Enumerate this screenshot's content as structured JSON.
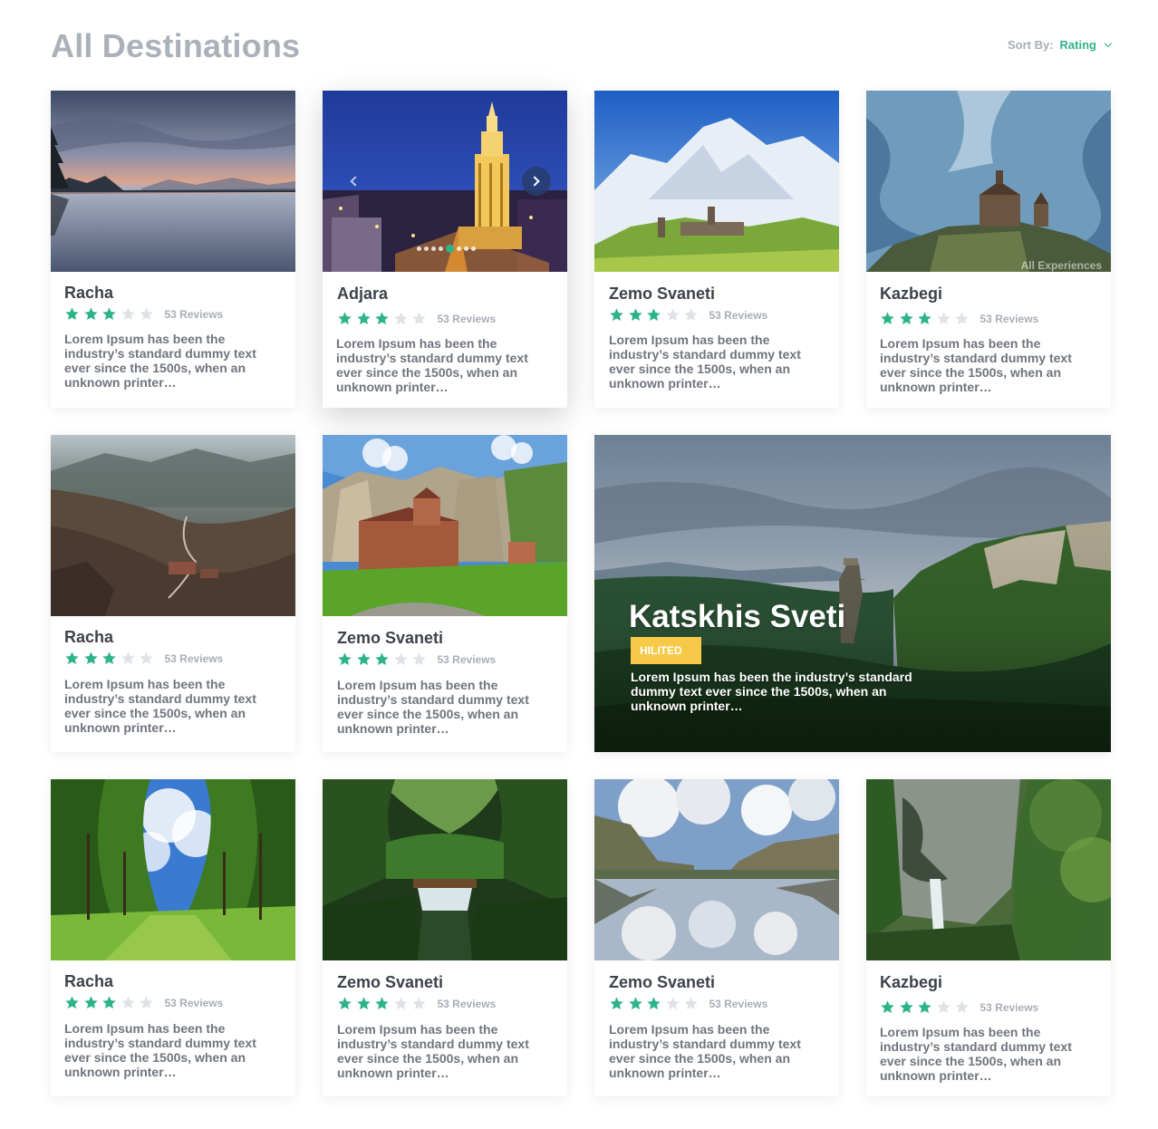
{
  "header": {
    "title": "All Destinations",
    "sort_label": "Sort By:",
    "sort_value": "Rating"
  },
  "cards": [
    {
      "name": "Racha",
      "rating": 3,
      "reviews": "53 Reviews",
      "desc": "Lorem Ipsum has been the industry’s standard dummy text ever since the 1500s, when an unknown printer…",
      "image": "lake-reflection-sunset"
    },
    {
      "name": "Adjara",
      "rating": 3,
      "reviews": "53 Reviews",
      "desc": "Lorem Ipsum has been the industry’s standard dummy text ever since the 1500s, when an unknown printer…",
      "image": "city-night-tower"
    },
    {
      "name": "Zemo Svaneti",
      "rating": 3,
      "reviews": "53 Reviews",
      "desc": "Lorem Ipsum has been the industry’s standard dummy text ever since the 1500s, when an unknown printer…",
      "image": "snow-mountain-village"
    },
    {
      "name": "Kazbegi",
      "rating": 3,
      "reviews": "53 Reviews",
      "desc": "Lorem Ipsum has been the industry’s standard dummy text ever since the 1500s, when an unknown printer…",
      "image": "church-snow-mountain",
      "overlay_link": "All Experiences"
    },
    {
      "name": "Racha",
      "rating": 3,
      "reviews": "53 Reviews",
      "desc": "Lorem Ipsum has been the industry’s standard dummy text ever since the 1500s, when an unknown printer…",
      "image": "valley-mountains"
    },
    {
      "name": "Zemo Svaneti",
      "rating": 3,
      "reviews": "53 Reviews",
      "desc": "Lorem Ipsum has been the industry’s standard dummy text ever since the 1500s, when an unknown printer…",
      "image": "monastery-cliffs"
    },
    {
      "name": "Racha",
      "rating": 3,
      "reviews": "53 Reviews",
      "desc": "Lorem Ipsum has been the industry’s standard dummy text ever since the 1500s, when an unknown printer…",
      "image": "tree-alley"
    },
    {
      "name": "Zemo Svaneti",
      "rating": 3,
      "reviews": "53 Reviews",
      "desc": "Lorem Ipsum has been the industry’s standard dummy text ever since the 1500s, when an unknown printer…",
      "image": "forest-waterfall"
    },
    {
      "name": "Zemo Svaneti",
      "rating": 3,
      "reviews": "53 Reviews",
      "desc": "Lorem Ipsum has been the industry’s standard dummy text ever since the 1500s, when an unknown printer…",
      "image": "mountain-lake-clouds"
    },
    {
      "name": "Kazbegi",
      "rating": 3,
      "reviews": "53 Reviews",
      "desc": "Lorem Ipsum has been the industry’s standard dummy text ever since the 1500s, when an unknown printer…",
      "image": "canyon-waterfall"
    }
  ],
  "featured": {
    "name": "Katskhis Sveti",
    "badge": "HILITED",
    "desc": "Lorem Ipsum has been the industry’s standard dummy text ever since the 1500s, when an unknown printer…",
    "image": "pillar-forest-valley"
  },
  "colors": {
    "accent": "#2db38a",
    "badge": "#f7c948",
    "title": "#aab1bb"
  },
  "icons": {
    "star": "star-icon",
    "next": "chevron-right-icon",
    "prev": "chevron-left-icon",
    "sort": "chevron-down-icon"
  }
}
